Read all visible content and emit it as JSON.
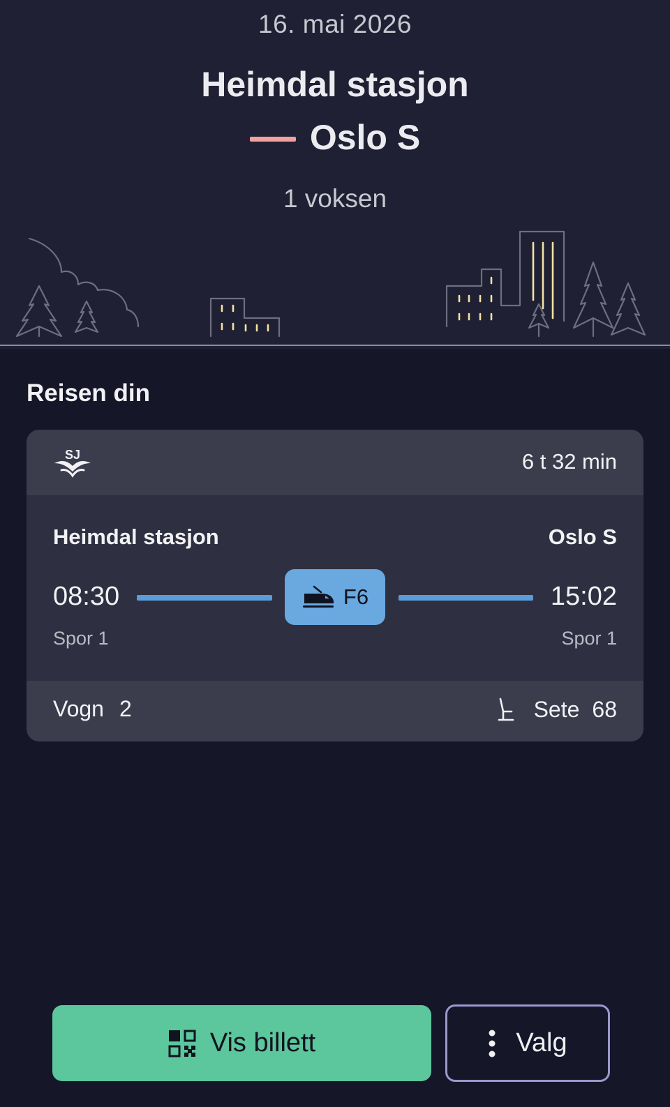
{
  "header": {
    "date": "16. mai 2026",
    "from_station": "Heimdal stasjon",
    "to_station": "Oslo S",
    "passengers": "1 voksen"
  },
  "journey": {
    "section_title": "Reisen din",
    "operator_logo": "SJ",
    "duration": "6 t 32 min",
    "from_station": "Heimdal stasjon",
    "to_station": "Oslo S",
    "departure_time": "08:30",
    "arrival_time": "15:02",
    "departure_track": "Spor 1",
    "arrival_track": "Spor 1",
    "train_line": "F6",
    "train_icon": "train-icon",
    "coach_label": "Vogn",
    "coach_number": "2",
    "seat_icon": "seat-icon",
    "seat_label": "Sete",
    "seat_number": "68"
  },
  "actions": {
    "show_ticket_label": "Vis billett",
    "show_ticket_icon": "qr-code-icon",
    "options_label": "Valg",
    "options_icon": "more-vertical-icon"
  },
  "colors": {
    "hero_background": "#1f2033",
    "page_background": "#151628",
    "card_background": "#2e3041",
    "route_accent": "#5b9bd6",
    "train_badge": "#6aa8e0",
    "destination_dash": "#f3a0a0",
    "primary_button": "#5cc69c",
    "secondary_border": "#9b98cf"
  }
}
